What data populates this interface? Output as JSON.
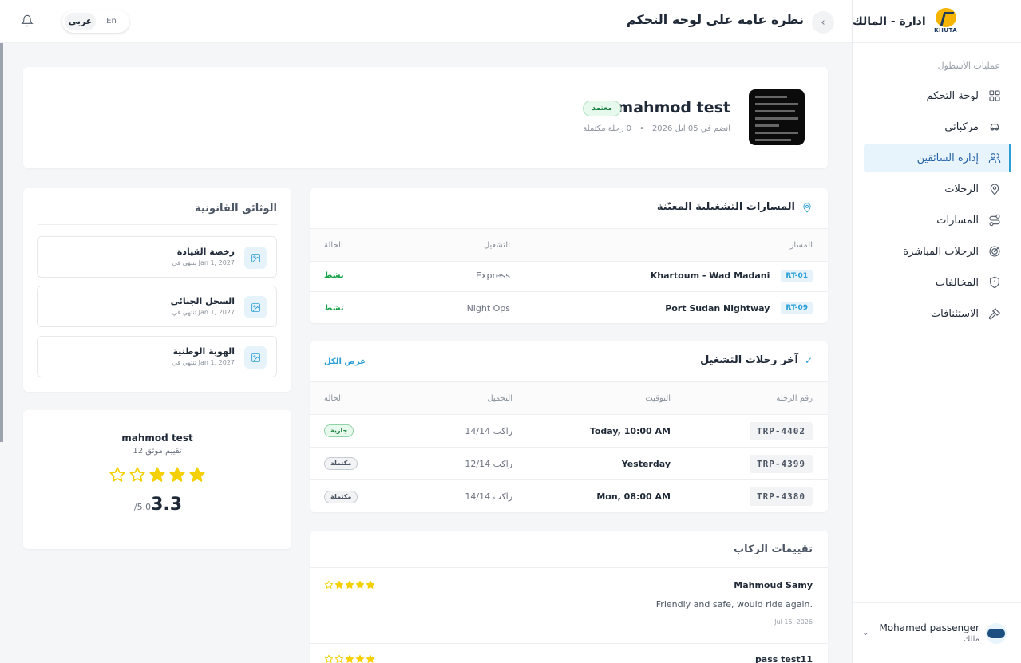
{
  "brand": {
    "title": "ادارة - المالك",
    "logo_text": "KHUTA"
  },
  "sidebar": {
    "section_label": "عمليات الأسطول",
    "items": [
      {
        "label": "لوحة التحكم",
        "icon": "dashboard-icon",
        "active": false
      },
      {
        "label": "مركباتي",
        "icon": "car-icon",
        "active": false
      },
      {
        "label": "إدارة السائقين",
        "icon": "users-icon",
        "active": true
      },
      {
        "label": "الرحلات",
        "icon": "map-pin-icon",
        "active": false
      },
      {
        "label": "المسارات",
        "icon": "route-icon",
        "active": false
      },
      {
        "label": "الرحلات المباشرة",
        "icon": "radar-icon",
        "active": false
      },
      {
        "label": "المخالفات",
        "icon": "shield-icon",
        "active": false
      },
      {
        "label": "الاستئنافات",
        "icon": "gavel-icon",
        "active": false
      }
    ]
  },
  "user": {
    "name": "Mohamed passenger",
    "role": "مالك"
  },
  "topbar": {
    "title": "نظرة عامة على لوحة التحكم",
    "lang_ar": "عربي",
    "lang_en": "En"
  },
  "profile": {
    "name": "mahmod test",
    "badge": "معتمد",
    "joined": "انضم في 05 ابل 2026",
    "trips": "0 رحلة مكتملة"
  },
  "documents": {
    "title": "الوثائق القانونية",
    "items": [
      {
        "title": "رخصة القيادة",
        "expiry": "تنتهي في Jan 1, 2027"
      },
      {
        "title": "السجل الجنائي",
        "expiry": "تنتهي في Jan 1, 2027"
      },
      {
        "title": "الهوية الوطنية",
        "expiry": "تنتهي في Jan 1, 2027"
      }
    ]
  },
  "rating": {
    "name": "mahmod test",
    "count": "12 تقييم موثق",
    "score": "3.3",
    "max": "/5.0",
    "stars": 3
  },
  "routes": {
    "title": "المسارات التشغيلية المعيّنة",
    "headers": {
      "route": "المسار",
      "ops": "التشغيل",
      "status": "الحالة"
    },
    "rows": [
      {
        "code": "RT-01",
        "name": "Khartoum - Wad Madani",
        "ops": "Express",
        "status": "نشط"
      },
      {
        "code": "RT-09",
        "name": "Port Sudan Nightway",
        "ops": "Night Ops",
        "status": "نشط"
      }
    ]
  },
  "trips": {
    "title": "آخر رحلات التشغيل",
    "view_all": "عرض الكل",
    "headers": {
      "id": "رقم الرحلة",
      "time": "التوقيت",
      "load": "التحميل",
      "status": "الحالة"
    },
    "rows": [
      {
        "id": "TRP-4402",
        "time": "Today, 10:00 AM",
        "load": "14/14 راكب",
        "status": "جارية",
        "kind": "run"
      },
      {
        "id": "TRP-4399",
        "time": "Yesterday",
        "load": "12/14 راكب",
        "status": "مكتملة",
        "kind": "done"
      },
      {
        "id": "TRP-4380",
        "time": "Mon, 08:00 AM",
        "load": "14/14 راكب",
        "status": "مكتملة",
        "kind": "done"
      }
    ]
  },
  "reviews": {
    "title": "تقييمات الركاب",
    "items": [
      {
        "name": "Mahmoud Samy",
        "text": "Friendly and safe, would ride again.",
        "date": "Jul 15, 2026",
        "stars": 4
      },
      {
        "name": "pass test11",
        "text": "",
        "date": "",
        "stars": 3
      }
    ]
  },
  "colors": {
    "accent": "#2a9fd6",
    "star": "#f5d000",
    "success": "#17a34a"
  }
}
